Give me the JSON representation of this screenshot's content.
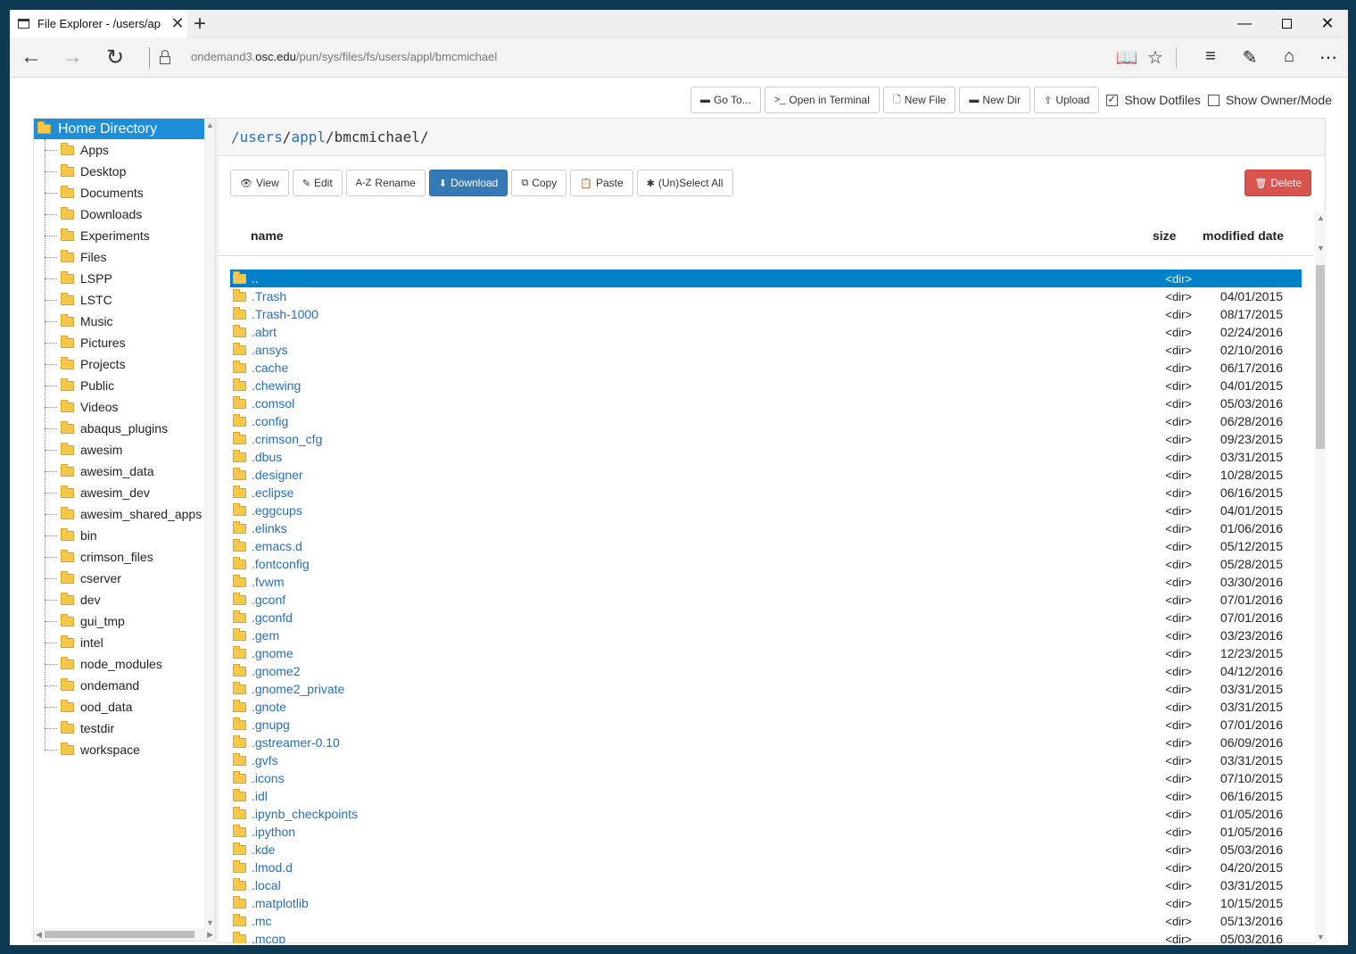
{
  "browser": {
    "tab_title": "File Explorer - /users/ap",
    "url_prefix": "ondemand3.",
    "url_host": "osc.edu",
    "url_path": "/pun/sys/files/fs/users/appl/bmcmichael"
  },
  "toolbar": {
    "goto_label": "Go To...",
    "terminal_label": "Open in Terminal",
    "newfile_label": "New File",
    "newdir_label": "New Dir",
    "upload_label": "Upload",
    "show_dotfiles_label": "Show Dotfiles",
    "show_dotfiles_checked": true,
    "show_owner_label": "Show Owner/Mode",
    "show_owner_checked": false
  },
  "sidebar": {
    "root_label": "Home Directory",
    "items": [
      "Apps",
      "Desktop",
      "Documents",
      "Downloads",
      "Experiments",
      "Files",
      "LSPP",
      "LSTC",
      "Music",
      "Pictures",
      "Projects",
      "Public",
      "Videos",
      "abaqus_plugins",
      "awesim",
      "awesim_data",
      "awesim_dev",
      "awesim_shared_apps",
      "bin",
      "crimson_files",
      "cserver",
      "dev",
      "gui_tmp",
      "intel",
      "node_modules",
      "ondemand",
      "ood_data",
      "testdir",
      "workspace"
    ]
  },
  "main": {
    "path_seg1": "/users",
    "path_seg2": "appl",
    "path_rest": "bmcmichael/",
    "actions": {
      "view": "View",
      "edit": "Edit",
      "rename": "Rename",
      "download": "Download",
      "copy": "Copy",
      "paste": "Paste",
      "select_all": "(Un)Select All",
      "delete": "Delete"
    },
    "columns": {
      "name": "name",
      "size": "size",
      "date": "modified date"
    },
    "files": [
      {
        "name": "..",
        "size": "<dir>",
        "date": "",
        "selected": true
      },
      {
        "name": ".Trash",
        "size": "<dir>",
        "date": "04/01/2015"
      },
      {
        "name": ".Trash-1000",
        "size": "<dir>",
        "date": "08/17/2015"
      },
      {
        "name": ".abrt",
        "size": "<dir>",
        "date": "02/24/2016"
      },
      {
        "name": ".ansys",
        "size": "<dir>",
        "date": "02/10/2016"
      },
      {
        "name": ".cache",
        "size": "<dir>",
        "date": "06/17/2016"
      },
      {
        "name": ".chewing",
        "size": "<dir>",
        "date": "04/01/2015"
      },
      {
        "name": ".comsol",
        "size": "<dir>",
        "date": "05/03/2016"
      },
      {
        "name": ".config",
        "size": "<dir>",
        "date": "06/28/2016"
      },
      {
        "name": ".crimson_cfg",
        "size": "<dir>",
        "date": "09/23/2015"
      },
      {
        "name": ".dbus",
        "size": "<dir>",
        "date": "03/31/2015"
      },
      {
        "name": ".designer",
        "size": "<dir>",
        "date": "10/28/2015"
      },
      {
        "name": ".eclipse",
        "size": "<dir>",
        "date": "06/16/2015"
      },
      {
        "name": ".eggcups",
        "size": "<dir>",
        "date": "04/01/2015"
      },
      {
        "name": ".elinks",
        "size": "<dir>",
        "date": "01/06/2016"
      },
      {
        "name": ".emacs.d",
        "size": "<dir>",
        "date": "05/12/2015"
      },
      {
        "name": ".fontconfig",
        "size": "<dir>",
        "date": "05/28/2015"
      },
      {
        "name": ".fvwm",
        "size": "<dir>",
        "date": "03/30/2016"
      },
      {
        "name": ".gconf",
        "size": "<dir>",
        "date": "07/01/2016"
      },
      {
        "name": ".gconfd",
        "size": "<dir>",
        "date": "07/01/2016"
      },
      {
        "name": ".gem",
        "size": "<dir>",
        "date": "03/23/2016"
      },
      {
        "name": ".gnome",
        "size": "<dir>",
        "date": "12/23/2015"
      },
      {
        "name": ".gnome2",
        "size": "<dir>",
        "date": "04/12/2016"
      },
      {
        "name": ".gnome2_private",
        "size": "<dir>",
        "date": "03/31/2015"
      },
      {
        "name": ".gnote",
        "size": "<dir>",
        "date": "03/31/2015"
      },
      {
        "name": ".gnupg",
        "size": "<dir>",
        "date": "07/01/2016"
      },
      {
        "name": ".gstreamer-0.10",
        "size": "<dir>",
        "date": "06/09/2016"
      },
      {
        "name": ".gvfs",
        "size": "<dir>",
        "date": "03/31/2015"
      },
      {
        "name": ".icons",
        "size": "<dir>",
        "date": "07/10/2015"
      },
      {
        "name": ".idl",
        "size": "<dir>",
        "date": "06/16/2015"
      },
      {
        "name": ".ipynb_checkpoints",
        "size": "<dir>",
        "date": "01/05/2016"
      },
      {
        "name": ".ipython",
        "size": "<dir>",
        "date": "01/05/2016"
      },
      {
        "name": ".kde",
        "size": "<dir>",
        "date": "05/03/2016"
      },
      {
        "name": ".lmod.d",
        "size": "<dir>",
        "date": "04/20/2015"
      },
      {
        "name": ".local",
        "size": "<dir>",
        "date": "03/31/2015"
      },
      {
        "name": ".matplotlib",
        "size": "<dir>",
        "date": "10/15/2015"
      },
      {
        "name": ".mc",
        "size": "<dir>",
        "date": "05/13/2016"
      },
      {
        "name": ".mcop",
        "size": "<dir>",
        "date": "05/03/2016"
      }
    ]
  }
}
